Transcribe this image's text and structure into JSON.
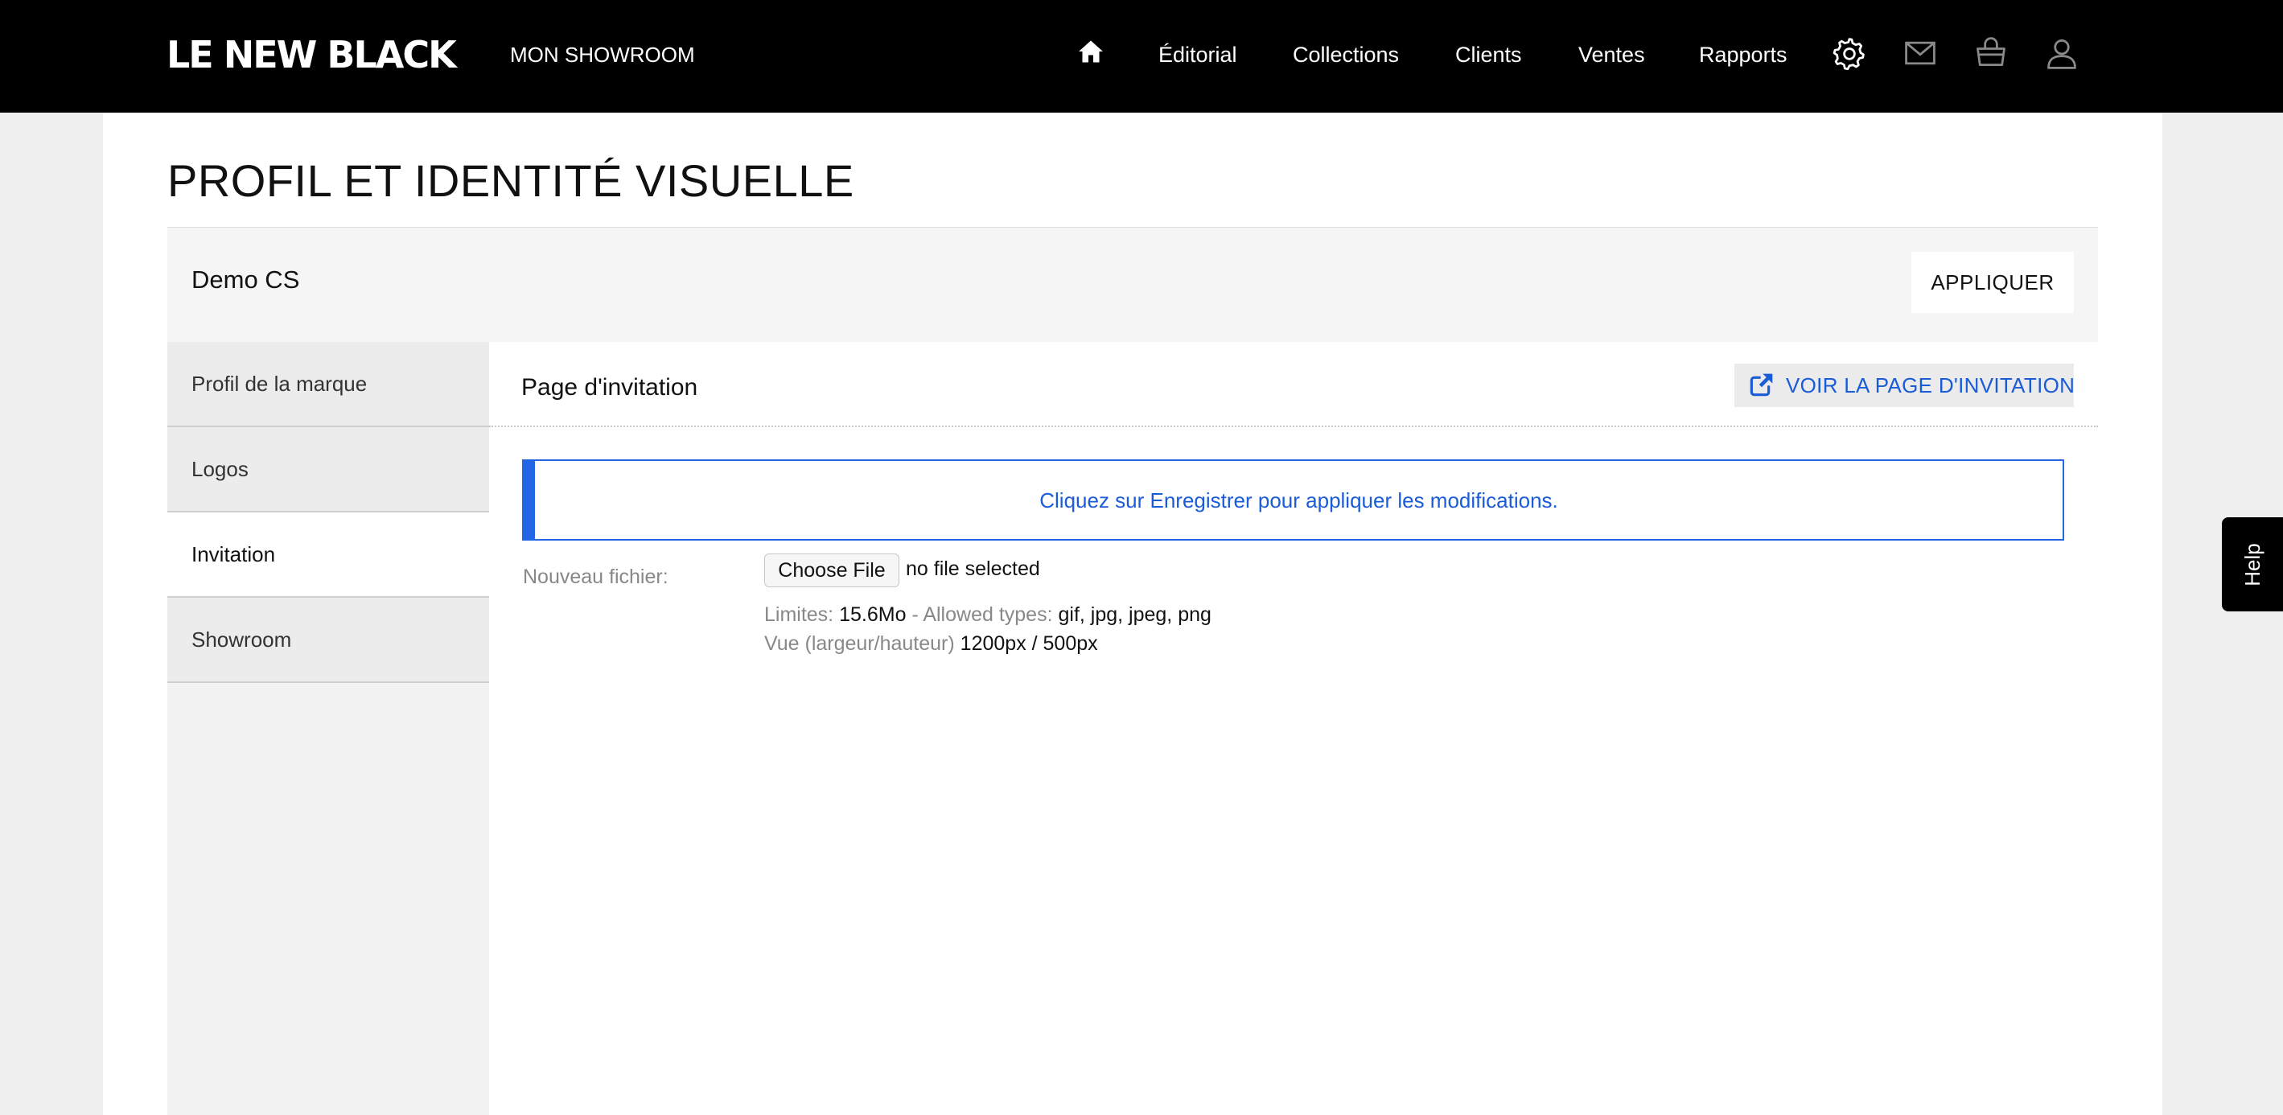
{
  "header": {
    "brand": "LE NEW BLACK",
    "section": "MON SHOWROOM",
    "nav": [
      {
        "label": "Éditorial"
      },
      {
        "label": "Collections"
      },
      {
        "label": "Clients"
      },
      {
        "label": "Ventes"
      },
      {
        "label": "Rapports"
      }
    ],
    "icons": [
      "home-icon",
      "gear-icon",
      "mail-icon",
      "basket-icon",
      "user-icon"
    ]
  },
  "page": {
    "title": "PROFIL ET IDENTITÉ VISUELLE",
    "brand_name": "Demo CS",
    "apply_label": "APPLIQUER"
  },
  "sidebar": {
    "items": [
      {
        "label": "Profil de la marque"
      },
      {
        "label": "Logos"
      },
      {
        "label": "Invitation",
        "active": true
      },
      {
        "label": "Showroom"
      }
    ]
  },
  "panel": {
    "title": "Page d'invitation",
    "view_button": "VOIR LA PAGE D'INVITATION",
    "alert": "Cliquez sur Enregistrer pour appliquer les modifications.",
    "file_label": "Nouveau fichier:",
    "file_button": "Choose File",
    "file_status": "no file selected",
    "limits_label": "Limites:",
    "limits_value": "15.6Mo",
    "types_label": "- Allowed types:",
    "types_value": "gif, jpg, jpeg, png",
    "dimensions_label": "Vue (largeur/hauteur)",
    "dimensions_value": "1200px / 500px"
  },
  "help": {
    "label": "Help"
  },
  "colors": {
    "accent": "#2266e6",
    "link": "#1a5bd6",
    "header_bg": "#000000"
  }
}
